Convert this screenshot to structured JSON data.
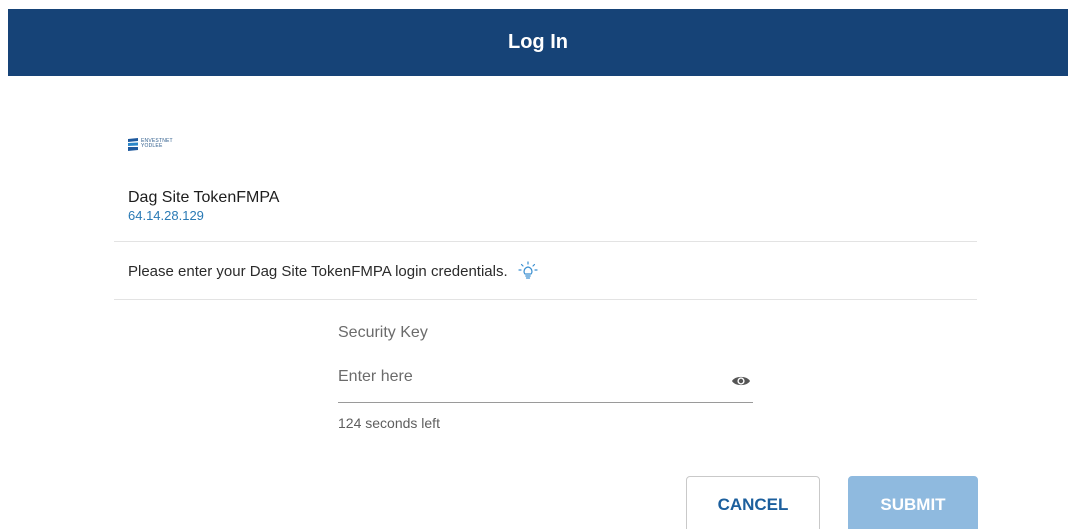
{
  "header": {
    "title": "Log In"
  },
  "logo": {
    "line1": "ENVESTNET",
    "line2": "YODLEE",
    "icon": "envestnet-yodlee-logo"
  },
  "site": {
    "name": "Dag Site TokenFMPA",
    "address": "64.14.28.129"
  },
  "instructions": {
    "text": "Please enter your Dag Site TokenFMPA login credentials.",
    "icon": "lightbulb-icon"
  },
  "form": {
    "security_key_label": "Security Key",
    "security_key_placeholder": "Enter here",
    "security_key_value": "",
    "show_icon": "eye-icon",
    "timer_text": "124 seconds left"
  },
  "buttons": {
    "cancel_label": "CANCEL",
    "submit_label": "SUBMIT"
  },
  "colors": {
    "header_bg": "#164377",
    "link": "#2a7ab5",
    "cancel_text": "#1c5f9d",
    "submit_bg_disabled": "#8fbadf"
  }
}
